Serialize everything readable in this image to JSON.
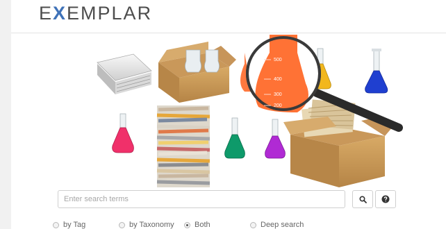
{
  "header": {
    "logo_pre": "E",
    "logo_x": "X",
    "logo_post": "EMPLAR"
  },
  "search": {
    "placeholder": "Enter search terms",
    "value": ""
  },
  "buttons": {
    "search_icon": "search-icon",
    "help_icon": "help-icon"
  },
  "options": [
    {
      "label": "by Tag",
      "checked": false
    },
    {
      "label": "by Taxonomy",
      "checked": false
    },
    {
      "label": "Both",
      "checked": true
    },
    {
      "label": "Deep search",
      "checked": false
    }
  ],
  "hero": {
    "beaker_labels": [
      "500",
      "400",
      "300",
      "200"
    ],
    "colors": {
      "orange": "#ff6a2a",
      "pink": "#f0306a",
      "green": "#0e9a6a",
      "purple": "#b02ad4",
      "blue": "#1f3fd0",
      "amber": "#f2b71d"
    }
  }
}
